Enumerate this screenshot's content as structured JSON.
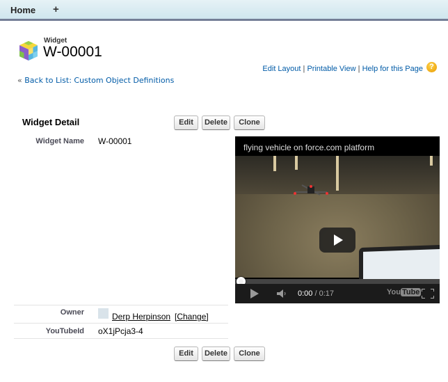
{
  "nav": {
    "tabs": [
      {
        "label": "Home"
      },
      {
        "label": "+",
        "icon": "plus-icon"
      }
    ]
  },
  "header": {
    "object_type": "Widget",
    "record_name": "W-00001",
    "icon": "custom-object-cube-icon"
  },
  "links": {
    "edit_layout": "Edit Layout",
    "printable_view": "Printable View",
    "help": "Help for this Page",
    "separator": "|",
    "help_icon": "?"
  },
  "back": {
    "prefix": "«",
    "label": "Back to List: Custom Object Definitions"
  },
  "detail": {
    "title": "Widget Detail",
    "buttons": {
      "edit": "Edit",
      "delete": "Delete",
      "clone": "Clone"
    },
    "fields": [
      {
        "label": "Widget Name",
        "value": "W-00001"
      },
      {
        "label": "Owner",
        "value": "Derp Herpinson",
        "action": "[Change]"
      },
      {
        "label": "YouTubeId",
        "value": "oX1jPcja3-4"
      }
    ]
  },
  "video": {
    "title": "flying vehicle on force.com platform",
    "current_time": "0:00",
    "duration": "/ 0:17",
    "progress_fraction": 0.0,
    "logo_you": "You",
    "logo_tube": "Tube"
  },
  "colors": {
    "link": "#015ba7",
    "nav_border": "#747e96"
  }
}
